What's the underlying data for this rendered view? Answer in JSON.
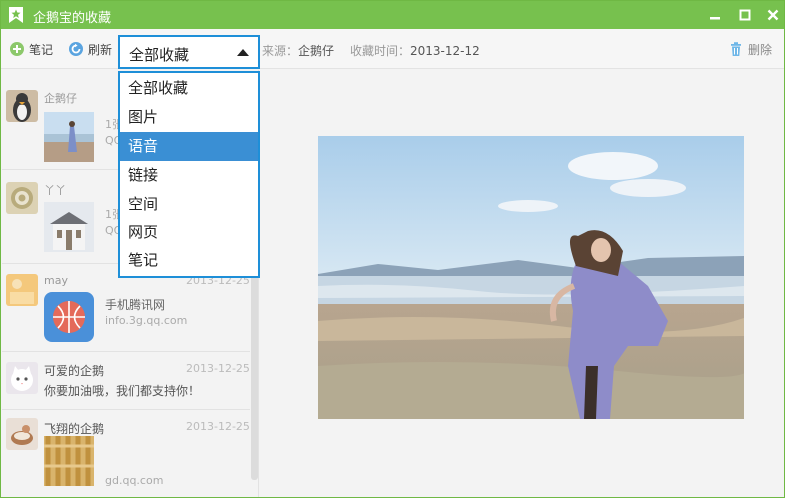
{
  "window": {
    "title": "企鹅宝的收藏"
  },
  "toolbar": {
    "note_label": "笔记",
    "refresh_label": "刷新",
    "source_label": "来源：",
    "source_value": "企鹅仔",
    "time_label": "收藏时间：",
    "time_value": "2013-12-12",
    "delete_label": "删除"
  },
  "filter": {
    "selected": "全部收藏",
    "options": [
      "全部收藏",
      "图片",
      "语音",
      "链接",
      "空间",
      "网页",
      "笔记"
    ],
    "highlighted": "语音"
  },
  "items": [
    {
      "name": "企鹅仔",
      "desc": "1张",
      "sub": "QQ"
    },
    {
      "name": "丫丫",
      "desc": "1张",
      "sub": "QQ"
    },
    {
      "name": "may",
      "date": "2013-12-25",
      "title": "手机腾讯网",
      "url": "info.3g.qq.com"
    },
    {
      "name": "可爱的企鹅",
      "date": "2013-12-25",
      "text": "你要加油哦，我们都支持你！"
    },
    {
      "name": "飞翔的企鹅",
      "date": "2013-12-25",
      "url": "gd.qq.com"
    }
  ],
  "colors": {
    "titlebar": "#77c14e",
    "selection_blue": "#3a8fd4",
    "select_border": "#1e8fd8"
  }
}
